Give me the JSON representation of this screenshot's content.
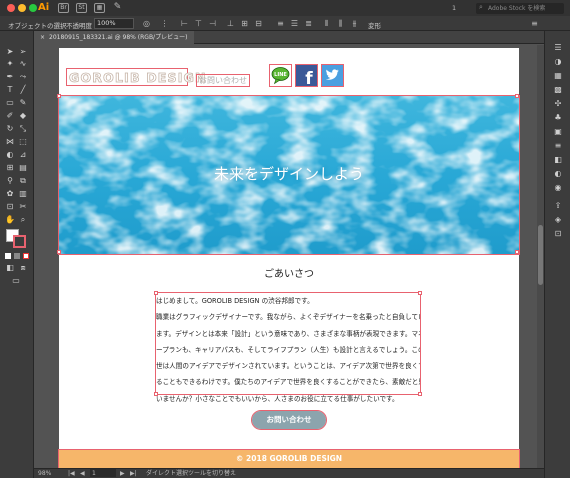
{
  "window": {
    "app_name": "Ai",
    "toolbar_icons": [
      "Br",
      "St"
    ],
    "search_placeholder": "Adobe Stock を検索",
    "page_indicator": "1"
  },
  "control_bar": {
    "selection_label": "オブジェクトの選択",
    "opacity_label": "不透明度",
    "opacity_value": "100%",
    "transform_label": "変形"
  },
  "document": {
    "tab_label": "20180915_183321.ai @ 98% (RGB/プレビュー)"
  },
  "status": {
    "zoom": "98%",
    "artboard_number": "1",
    "tool_hint": "ダイレクト選択ツールを切り替え"
  },
  "site": {
    "logo_text": "GOROLIB DESIGN",
    "contact_link": "お問い合わせ",
    "icons": [
      "line-icon",
      "facebook-icon",
      "twitter-icon"
    ],
    "line_badge_text": "LINE",
    "facebook_glyph": "f",
    "hero_title": "未来をデザインしよう",
    "greeting_title": "ごあいさつ",
    "greeting_lines": [
      "はじめまして。GOROLIB DESIGN の渋谷邦郎です。",
      "職業はグラフィックデザイナーです。我ながら、よくぞデザイナーを名乗ったと自負してい",
      "ます。デザインとは本来「設計」という意味であり、さまざまな事柄が表現できます。マネ",
      "ープランも、キャリアパスも、そしてライフプラン（人生）も設計と言えるでしょう。この",
      "世は人間のアイデアでデザインされています。ということは、アイデア次第で世界を良くす",
      "ることもできるわけです。僕たちのアイデアで世界を良くすることができたら、素敵だと思",
      "いませんか？小さなことでもいいから、人さまのお役に立てる仕事がしたいです。"
    ],
    "contact_button": "お問い合わせ",
    "footer_text": "© 2018 GOROLIB DESIGN"
  },
  "colors": {
    "selection": "#e8626f",
    "footer_bg": "#f6b66a",
    "button_bg": "#8ca4ad",
    "twitter": "#4a9fe0",
    "facebook": "#3b5998",
    "line": "#57b530"
  }
}
